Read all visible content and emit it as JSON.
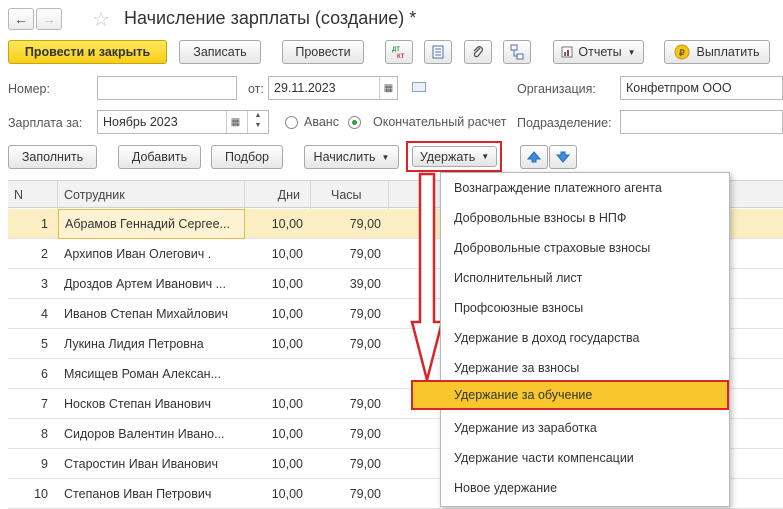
{
  "window": {
    "title": "Начисление зарплаты (создание) *"
  },
  "toolbar": {
    "post_close": "Провести и закрыть",
    "save": "Записать",
    "post": "Провести",
    "dtkt": "ДТ КТ",
    "reports": "Отчеты",
    "pay": "Выплатить"
  },
  "form": {
    "number_label": "Номер:",
    "number_value": "",
    "date_label": "от:",
    "date_value": "29.11.2023",
    "org_label": "Организация:",
    "org_value": "Конфетпром ООО",
    "salary_for_label": "Зарплата за:",
    "salary_for_value": "Ноябрь 2023",
    "advance_label": "Аванс",
    "final_label": "Окончательный расчет",
    "division_label": "Подразделение:",
    "division_value": ""
  },
  "actions": {
    "fill": "Заполнить",
    "add": "Добавить",
    "pick": "Подбор",
    "accrue": "Начислить",
    "withhold": "Удержать"
  },
  "table": {
    "headers": {
      "n": "N",
      "employee": "Сотрудник",
      "days": "Дни",
      "hours": "Часы"
    },
    "rows": [
      {
        "n": "1",
        "employee": "Абрамов Геннадий Сергее...",
        "days": "10,00",
        "hours": "79,00"
      },
      {
        "n": "2",
        "employee": "Архипов Иван Олегович .",
        "days": "10,00",
        "hours": "79,00"
      },
      {
        "n": "3",
        "employee": "Дроздов Артем Иванович ...",
        "days": "10,00",
        "hours": "39,00"
      },
      {
        "n": "4",
        "employee": "Иванов Степан Михайлович",
        "days": "10,00",
        "hours": "79,00"
      },
      {
        "n": "5",
        "employee": "Лукина Лидия Петровна",
        "days": "10,00",
        "hours": "79,00"
      },
      {
        "n": "6",
        "employee": "Мясищев Роман Алексан...",
        "days": "",
        "hours": ""
      },
      {
        "n": "7",
        "employee": "Носков Степан Иванович",
        "days": "10,00",
        "hours": "79,00"
      },
      {
        "n": "8",
        "employee": "Сидоров Валентин Ивано...",
        "days": "10,00",
        "hours": "79,00"
      },
      {
        "n": "9",
        "employee": "Старостин Иван Иванович",
        "days": "10,00",
        "hours": "79,00"
      },
      {
        "n": "10",
        "employee": "Степанов Иван Петрович",
        "days": "10,00",
        "hours": "79,00"
      }
    ]
  },
  "menu": {
    "items": [
      "Вознаграждение платежного агента",
      "Добровольные взносы в НПФ",
      "Добровольные страховые взносы",
      "Исполнительный лист",
      "Профсоюзные взносы",
      "Удержание в доход государства",
      "Удержание за взносы",
      "Удержание за обучение",
      "Удержание из заработка",
      "Удержание части компенсации",
      "Новое удержание"
    ],
    "highlighted_index": 7
  },
  "colors": {
    "accent_yellow": "#f7c72b",
    "annotation_red": "#d9252a",
    "selected_row": "#fbeec3"
  }
}
